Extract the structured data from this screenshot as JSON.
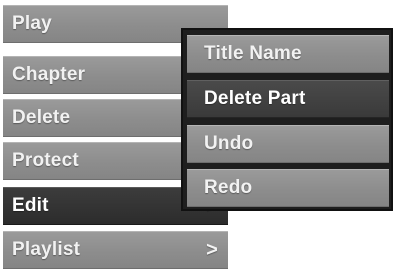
{
  "menu": {
    "items": [
      {
        "label": "Play"
      },
      {
        "label": "Chapter"
      },
      {
        "label": "Delete"
      },
      {
        "label": "Protect"
      },
      {
        "label": "Edit",
        "chevron": ">"
      },
      {
        "label": "Playlist",
        "chevron": ">"
      }
    ],
    "selected_index": 4
  },
  "submenu": {
    "items": [
      {
        "label": "Title Name"
      },
      {
        "label": "Delete Part"
      },
      {
        "label": "Undo"
      },
      {
        "label": "Redo"
      }
    ],
    "selected_index": 1
  },
  "colors": {
    "item_bg": "#8f8f8f",
    "selected_bg": "#303030",
    "submenu_frame": "#1e1e1e",
    "text": "#f2f2f2"
  }
}
